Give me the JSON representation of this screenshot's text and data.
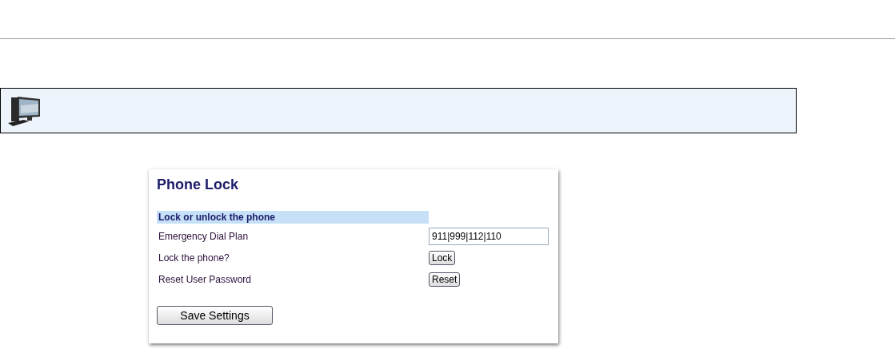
{
  "panel": {
    "title": "Phone Lock",
    "section": "Lock or unlock the phone",
    "rows": [
      {
        "kind": "field",
        "label": "Emergency Dial Plan",
        "value": "911|999|112|110"
      },
      {
        "kind": "button",
        "label": "Lock the phone?",
        "button": "Lock"
      },
      {
        "kind": "button",
        "label": "Reset User Password",
        "button": "Reset"
      }
    ],
    "save_button": "Save Settings"
  }
}
